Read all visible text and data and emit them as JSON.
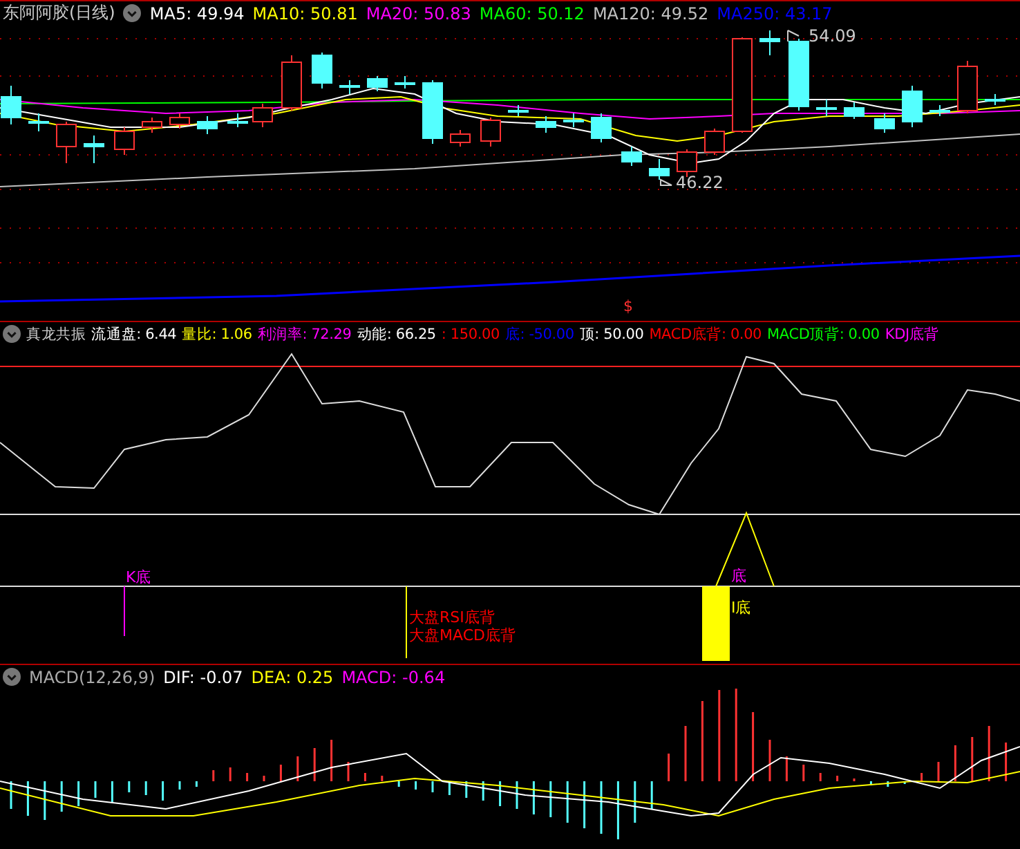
{
  "main_panel": {
    "title": "东阿阿胶(日线)",
    "indicators": [
      {
        "text": "MA5: 49.94",
        "color": "#ffffff"
      },
      {
        "text": "MA10: 50.81",
        "color": "#ffff00"
      },
      {
        "text": "MA20: 50.83",
        "color": "#ff00ff"
      },
      {
        "text": "MA60: 50.12",
        "color": "#00ff00"
      },
      {
        "text": "MA120: 49.52",
        "color": "#c0c0c0"
      },
      {
        "text": "MA250: 43.17",
        "color": "#0000ff"
      }
    ],
    "high_label": "54.09",
    "low_label": "46.22",
    "date_marker": "$"
  },
  "signal_panel": {
    "title": "真龙共振",
    "indicators": [
      {
        "text": "流通盘: 6.44",
        "color": "#ffffff"
      },
      {
        "text": "量比: 1.06",
        "color": "#ffff00"
      },
      {
        "text": "利润率: 72.29",
        "color": "#ff00ff"
      },
      {
        "text": "动能: 66.25",
        "color": "#ffffff"
      },
      {
        "text": ": 150.00",
        "color": "#ff0000"
      },
      {
        "text": "底: -50.00",
        "color": "#0000ff"
      },
      {
        "text": "顶: 50.00",
        "color": "#ffffff"
      },
      {
        "text": "MACD底背: 0.00",
        "color": "#ff0000"
      },
      {
        "text": "MACD顶背: 0.00",
        "color": "#00ff00"
      },
      {
        "text": "KDJ底背",
        "color": "#ff00ff"
      }
    ],
    "signals": [
      {
        "text": "K底",
        "color": "#ff00ff"
      },
      {
        "text": "大盘RSI底背",
        "color": "#ff0000"
      },
      {
        "text": "大盘MACD底背",
        "color": "#ff0000"
      },
      {
        "text": "底",
        "color": "#ff00ff"
      },
      {
        "text": "I底",
        "color": "#ffff00"
      }
    ]
  },
  "macd_panel": {
    "title": "MACD(12,26,9)",
    "indicators": [
      {
        "text": "DIF: -0.07",
        "color": "#ffffff"
      },
      {
        "text": "DEA: 0.25",
        "color": "#ffff00"
      },
      {
        "text": "MACD: -0.64",
        "color": "#ff00ff"
      }
    ]
  }
}
